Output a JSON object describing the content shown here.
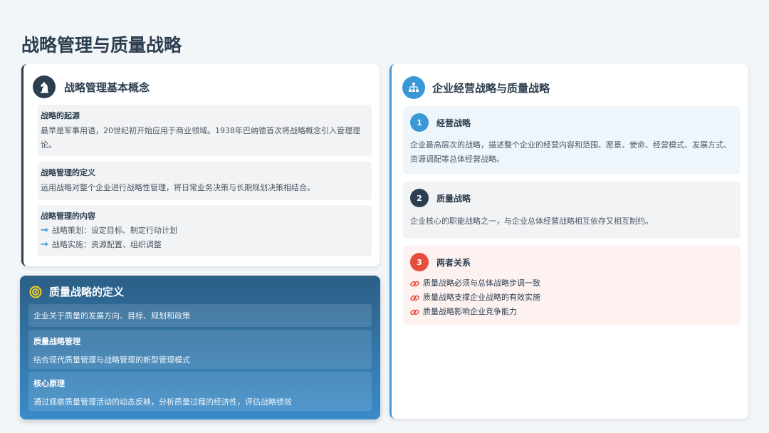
{
  "page": {
    "title": "战略管理与质量战略"
  },
  "concepts": {
    "title": "战略管理基本概念",
    "icon": "chess-knight-icon",
    "items": [
      {
        "title": "战略的起源",
        "desc": "最早是军事用语，20世纪初开始应用于商业领域。1938年巴纳德首次将战略概念引入管理理论。"
      },
      {
        "title": "战略管理的定义",
        "desc": "运用战略对整个企业进行战略性管理，将日常业务决策与长期规划决策相结合。"
      }
    ],
    "content": {
      "title": "战略管理的内容",
      "bullets": [
        "战略策划：设定目标、制定行动计划",
        "战略实施：资源配置、组织调整"
      ]
    }
  },
  "quality": {
    "title": "质量战略的定义",
    "icon": "target-icon",
    "intro": "企业关于质量的发展方向、目标、规划和政策",
    "items": [
      {
        "title": "质量战略管理",
        "desc": "结合现代质量管理与战略管理的新型管理模式"
      },
      {
        "title": "核心原理",
        "desc": "通过观察质量管理活动的动态反映，分析质量过程的经济性，评估战略绩效"
      }
    ]
  },
  "relation": {
    "title": "企业经营战略与质量战略",
    "icon": "sitemap-icon",
    "sections": [
      {
        "num": "1",
        "title": "经营战略",
        "desc": "企业最高层次的战略，描述整个企业的经营内容和范围、愿景、使命、经营模式、发展方式、资源调配等总体经营战略。"
      },
      {
        "num": "2",
        "title": "质量战略",
        "desc": "企业核心的职能战略之一，与企业总体经营战略相互依存又相互制约。"
      },
      {
        "num": "3",
        "title": "两者关系",
        "links": [
          "质量战略必须与总体战略步调一致",
          "质量战略支撑企业战略的有效实施",
          "质量战略影响企业竞争能力"
        ]
      }
    ]
  },
  "colors": {
    "dark": "#2c3e50",
    "blue": "#3a98d6",
    "red": "#e74c3c"
  }
}
